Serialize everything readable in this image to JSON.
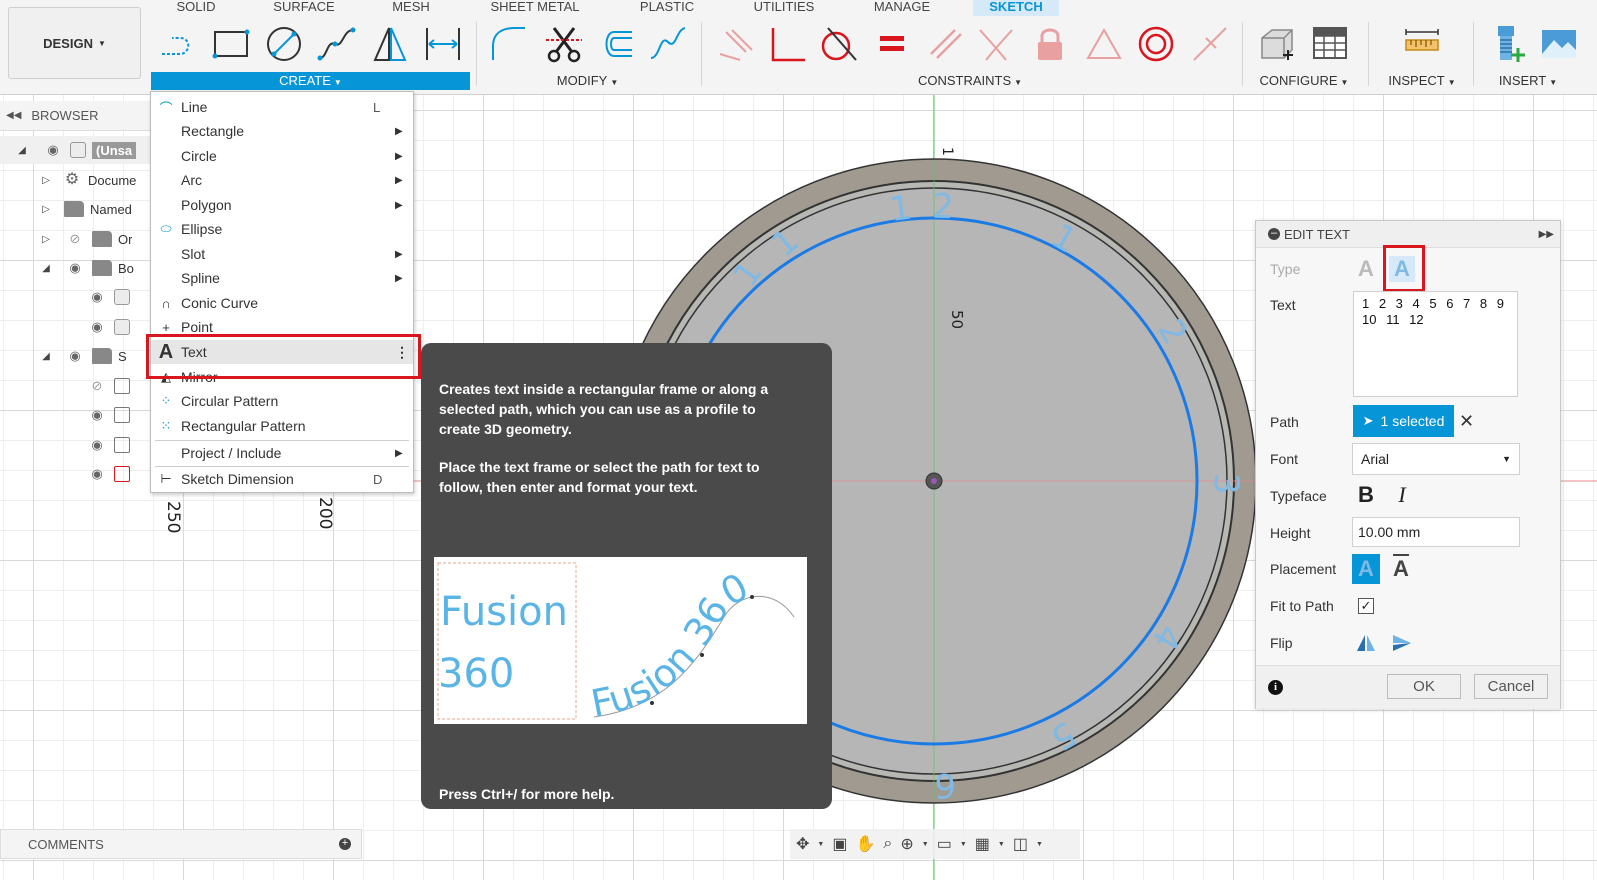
{
  "toolbar": {
    "workspace": "DESIGN",
    "tabs": [
      "SOLID",
      "SURFACE",
      "MESH",
      "SHEET METAL",
      "PLASTIC",
      "UTILITIES",
      "MANAGE",
      "SKETCH"
    ],
    "active_tab": "SKETCH",
    "groups": {
      "create": "CREATE",
      "modify": "MODIFY",
      "constraints": "CONSTRAINTS",
      "configure": "CONFIGURE",
      "inspect": "INSPECT",
      "insert": "INSERT"
    },
    "accent_color": "#0696d7"
  },
  "browser": {
    "title": "BROWSER",
    "items": [
      {
        "label": "(Unsa",
        "icon": "component-icon"
      },
      {
        "label": "Docume",
        "icon": "gear-icon"
      },
      {
        "label": "Named",
        "icon": "folder-icon"
      },
      {
        "label": "Or",
        "icon": "folder-icon"
      },
      {
        "label": "Bo",
        "icon": "folder-icon"
      },
      {
        "label": "",
        "icon": "body-icon"
      },
      {
        "label": "",
        "icon": "body-icon"
      },
      {
        "label": "S",
        "icon": "folder-icon"
      },
      {
        "label": "",
        "icon": "sketch-icon"
      },
      {
        "label": "",
        "icon": "sketch-icon"
      },
      {
        "label": "",
        "icon": "sketch-icon"
      },
      {
        "label": "",
        "icon": "sketch-icon"
      }
    ]
  },
  "comments": {
    "label": "COMMENTS"
  },
  "create_menu": {
    "items": [
      {
        "label": "Line",
        "shortcut": "L",
        "submenu": false
      },
      {
        "label": "Rectangle",
        "shortcut": "",
        "submenu": true
      },
      {
        "label": "Circle",
        "shortcut": "",
        "submenu": true
      },
      {
        "label": "Arc",
        "shortcut": "",
        "submenu": true
      },
      {
        "label": "Polygon",
        "shortcut": "",
        "submenu": true
      },
      {
        "label": "Ellipse",
        "shortcut": "",
        "submenu": false
      },
      {
        "label": "Slot",
        "shortcut": "",
        "submenu": true
      },
      {
        "label": "Spline",
        "shortcut": "",
        "submenu": true
      },
      {
        "label": "Conic Curve",
        "shortcut": "",
        "submenu": false
      },
      {
        "label": "Point",
        "shortcut": "",
        "submenu": false
      },
      {
        "label": "Text",
        "shortcut": "",
        "submenu": false
      },
      {
        "label": "Mirror",
        "shortcut": "",
        "submenu": false
      },
      {
        "label": "Circular Pattern",
        "shortcut": "",
        "submenu": false
      },
      {
        "label": "Rectangular Pattern",
        "shortcut": "",
        "submenu": false
      },
      {
        "label": "Project / Include",
        "shortcut": "",
        "submenu": true
      },
      {
        "label": "Sketch Dimension",
        "shortcut": "D",
        "submenu": false
      }
    ],
    "highlighted": "Text"
  },
  "tooltip": {
    "para1": "Creates text inside a rectangular frame or along a selected path, which you can use as a profile to create 3D geometry.",
    "para2": "Place the text frame or select the path for text to follow, then enter and format your text.",
    "image_text_frame": [
      "Fusion",
      "360"
    ],
    "image_text_path": "Fusion 360",
    "footer": "Press Ctrl+/ for more help."
  },
  "edit_text": {
    "title": "EDIT TEXT",
    "type_label": "Type",
    "text_label": "Text",
    "text_value": "1 2 3 4 5 6 7 8 9 10 11 12",
    "path_label": "Path",
    "path_value": "1 selected",
    "font_label": "Font",
    "font_value": "Arial",
    "typeface_label": "Typeface",
    "height_label": "Height",
    "height_value": "10.00 mm",
    "placement_label": "Placement",
    "fit_label": "Fit to Path",
    "fit_checked": true,
    "flip_label": "Flip",
    "ok_label": "OK",
    "cancel_label": "Cancel"
  },
  "canvas": {
    "dimension_label": "50",
    "ruler_labels": [
      "250",
      "200"
    ],
    "clock_numbers": [
      "1",
      "2",
      "1",
      "2",
      "3",
      "4",
      "5",
      "6",
      "1",
      "1"
    ],
    "sketch_color": "#1a7be6",
    "disk_color": "#8a8274"
  }
}
